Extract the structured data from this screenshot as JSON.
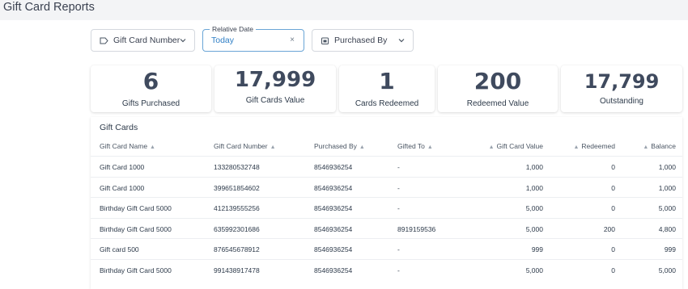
{
  "page": {
    "title": "Gift Card Reports"
  },
  "filters": {
    "gift_card_number": {
      "label": "Gift Card Number"
    },
    "relative_date": {
      "label": "Relative Date",
      "value": "Today",
      "clear": "×"
    },
    "purchased_by": {
      "label": "Purchased By"
    }
  },
  "stats": [
    {
      "value": "6",
      "label": "Gifts Purchased"
    },
    {
      "value": "17,999",
      "label": "Gift Cards Value"
    },
    {
      "value": "1",
      "label": "Cards Redeemed"
    },
    {
      "value": "200",
      "label": "Redeemed Value"
    },
    {
      "value": "17,799",
      "label": "Outstanding"
    }
  ],
  "table": {
    "title": "Gift Cards",
    "columns": [
      {
        "label": "Gift Card Name",
        "sort": "▲"
      },
      {
        "label": "Gift Card Number",
        "sort": "▲"
      },
      {
        "label": "Purchased By",
        "sort": "▲"
      },
      {
        "label": "Gifted To",
        "sort": "▲"
      },
      {
        "label": "Gift Card Value",
        "sort": "▲"
      },
      {
        "label": "Redeemed",
        "sort": "▲"
      },
      {
        "label": "Balance",
        "sort": "▲"
      }
    ],
    "rows": [
      [
        "Gift Card 1000",
        "133280532748",
        "8546936254",
        "-",
        "1,000",
        "0",
        "1,000"
      ],
      [
        "Gift Card 1000",
        "399651854602",
        "8546936254",
        "-",
        "1,000",
        "0",
        "1,000"
      ],
      [
        "Birthday Gift Card 5000",
        "412139555256",
        "8546936254",
        "-",
        "5,000",
        "0",
        "5,000"
      ],
      [
        "Birthday Gift Card 5000",
        "635992301686",
        "8546936254",
        "8919159536",
        "5,000",
        "200",
        "4,800"
      ],
      [
        "Gift card 500",
        "876545678912",
        "8546936254",
        "-",
        "999",
        "0",
        "999"
      ],
      [
        "Birthday Gift Card 5000",
        "991438917478",
        "8546936254",
        "-",
        "5,000",
        "0",
        "5,000"
      ]
    ]
  },
  "colors": {
    "accent": "#2f7fc6",
    "focus_border": "#6aa5d6",
    "text": "#2d3a4a"
  },
  "icons": {
    "gift_card_number": "tag-icon",
    "purchased_by": "calendar-icon",
    "dropdown": "chevron-down-icon"
  }
}
